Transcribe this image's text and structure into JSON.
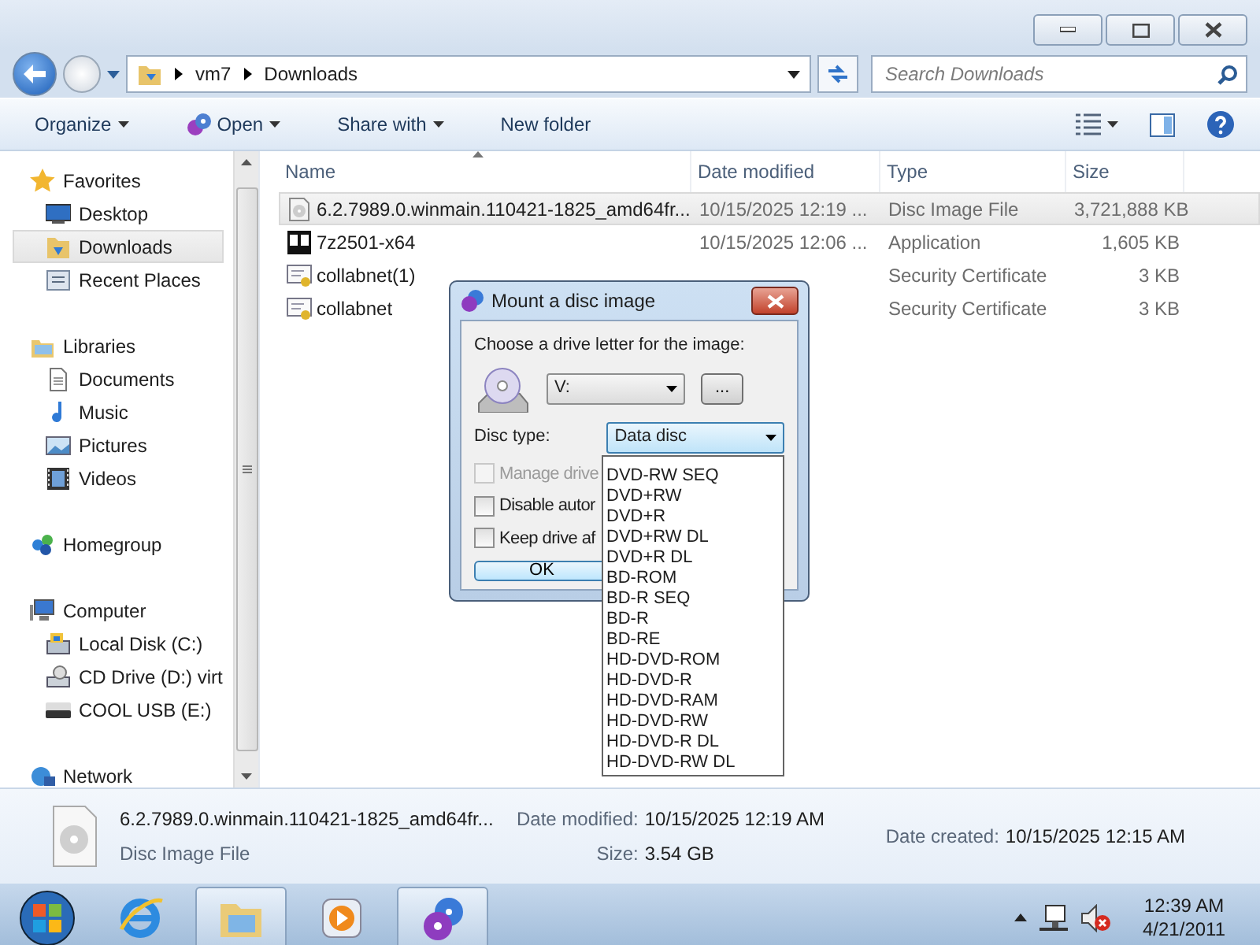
{
  "address": {
    "crumbs": [
      "vm7",
      "Downloads"
    ]
  },
  "search": {
    "placeholder": "Search Downloads"
  },
  "toolbar": [
    {
      "label": "Organize",
      "menu": true
    },
    {
      "label": "Open",
      "menu": true
    },
    {
      "label": "Share with",
      "menu": true
    },
    {
      "label": "New folder",
      "menu": false
    }
  ],
  "nav": {
    "sections": [
      {
        "label": "Favorites",
        "items": [
          {
            "label": "Desktop",
            "selected": false
          },
          {
            "label": "Downloads",
            "selected": true
          },
          {
            "label": "Recent Places",
            "selected": false
          }
        ]
      },
      {
        "label": "Libraries",
        "items": [
          {
            "label": "Documents",
            "selected": false
          },
          {
            "label": "Music",
            "selected": false
          },
          {
            "label": "Pictures",
            "selected": false
          },
          {
            "label": "Videos",
            "selected": false
          }
        ]
      },
      {
        "label": "Homegroup"
      },
      {
        "label": "Computer",
        "items": [
          {
            "label": "Local Disk (C:)",
            "selected": false
          },
          {
            "label": "CD Drive (D:) virt",
            "selected": false
          },
          {
            "label": "COOL USB (E:)",
            "selected": false
          }
        ]
      },
      {
        "label": "Network"
      }
    ]
  },
  "files": {
    "columns": [
      {
        "label": "Name",
        "sorted": true
      },
      {
        "label": "Date modified",
        "sorted": false
      },
      {
        "label": "Type",
        "sorted": false
      },
      {
        "label": "Size",
        "sorted": false
      }
    ],
    "rows": [
      {
        "name": "6.2.7989.0.winmain.110421-1825_amd64fr...",
        "date_modified": "10/15/2025 12:19 ...",
        "type": "Disc Image File",
        "size": "3,721,888 KB",
        "selected": true
      },
      {
        "name": "7z2501-x64",
        "date_modified": "10/15/2025 12:06 ...",
        "type": "Application",
        "size": "1,605 KB",
        "selected": false
      },
      {
        "name": "collabnet(1)",
        "type": "Security Certificate",
        "size": "3 KB",
        "selected": false
      },
      {
        "name": "collabnet",
        "type": "Security Certificate",
        "size": "3 KB",
        "selected": false
      }
    ]
  },
  "details": {
    "name": "6.2.7989.0.winmain.110421-1825_amd64fr...",
    "type": "Disc Image File",
    "modified_label": "Date modified:",
    "modified": "10/15/2025 12:19 AM",
    "created_label": "Date created:",
    "created": "10/15/2025 12:15 AM",
    "size_label": "Size:",
    "size": "3.54 GB"
  },
  "taskbar": {
    "buttons": [
      {
        "open": false
      },
      {
        "open": true
      },
      {
        "open": false
      },
      {
        "open": true
      }
    ],
    "time": "12:39 AM",
    "date": "4/21/2011"
  },
  "dialog": {
    "title": "Mount a disc image",
    "prompt": "Choose a drive letter for the image:",
    "drive": "V:",
    "browse": "...",
    "disc_type_label": "Disc type:",
    "disc_type": "Data disc",
    "options": [
      {
        "label": "Manage drive",
        "checked": false,
        "disabled": true
      },
      {
        "label": "Disable autor",
        "checked": false,
        "disabled": false
      },
      {
        "label": "Keep drive af",
        "checked": false,
        "disabled": false
      }
    ],
    "ok": "OK",
    "dropdown": [
      "DVD-RW SEQ",
      "DVD+RW",
      "DVD+R",
      "DVD+RW DL",
      "DVD+R DL",
      "BD-ROM",
      "BD-R SEQ",
      "BD-R",
      "BD-RE",
      "HD-DVD-ROM",
      "HD-DVD-R",
      "HD-DVD-RAM",
      "HD-DVD-RW",
      "HD-DVD-R DL",
      "HD-DVD-RW DL"
    ]
  }
}
